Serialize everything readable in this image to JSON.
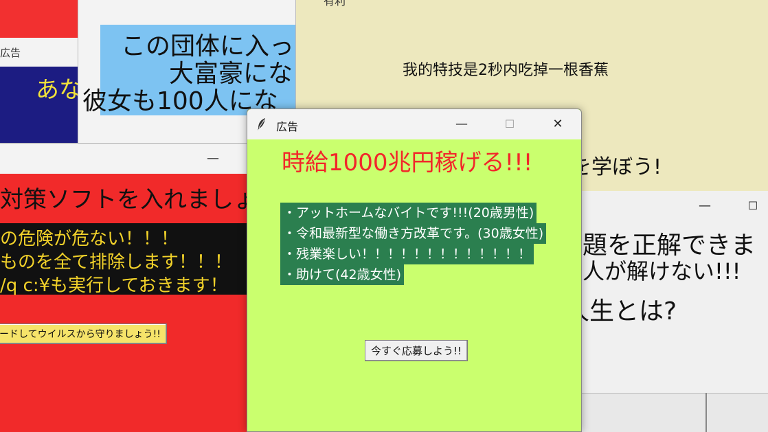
{
  "navy_window": {
    "title": "広告",
    "text": "あな"
  },
  "blue_window": {
    "lines": [
      "この団体に入っ",
      "大富豪にな",
      "彼女も100人にな"
    ]
  },
  "beige_window": {
    "top_text": "有利",
    "middle_text": "我的特技是2秒内吃掉一根香蕉",
    "bottom_text": "を学ぼう!"
  },
  "red_window": {
    "minimize": "—",
    "headline": "対策ソフトを入れましょう",
    "lines": [
      "の危険が危ない！！！",
      "ものを全て排除します！！！",
      "/q c:¥も実行しておきます！"
    ],
    "button": "ードしてウイルスから守りましょう!!"
  },
  "gray_window": {
    "minimize": "—",
    "maximize": "☐",
    "lines": [
      "題を正解できま",
      "人が解けない!!!",
      "人生とは?"
    ]
  },
  "main_window": {
    "title": "広告",
    "minimize": "—",
    "maximize": "☐",
    "close": "✕",
    "headline": "時給1000兆円稼げる!!!",
    "items": [
      "・アットホームなバイトです!!!(20歳男性)",
      "・令和最新型な働き方改革です。(30歳女性)",
      "・残業楽しい！！！！！！！！！！！！！",
      "・助けて(42歳女性)"
    ],
    "apply_button": "今すぐ応募しよう!!"
  }
}
